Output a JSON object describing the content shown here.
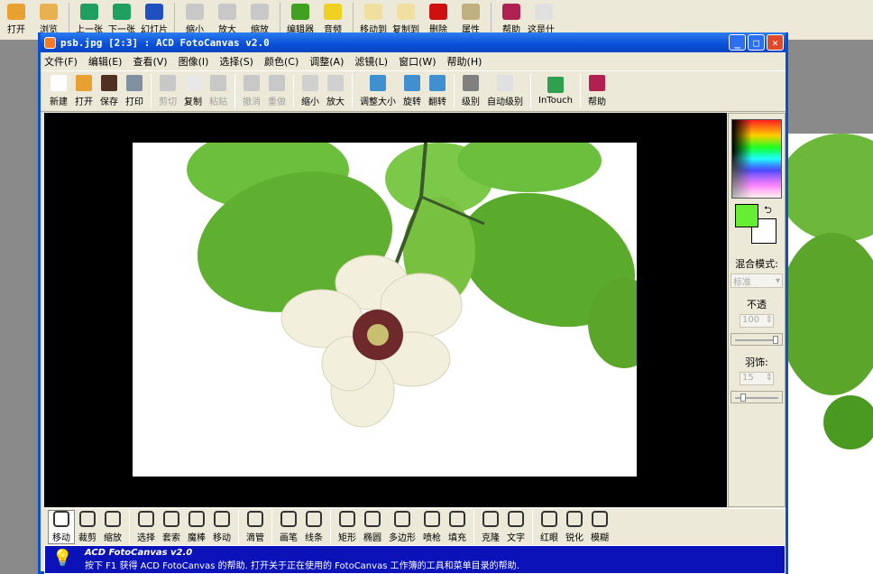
{
  "host_toolbar": [
    {
      "label": "打开",
      "icon": "open-folder-icon",
      "color": "#e8a030"
    },
    {
      "label": "浏览",
      "icon": "browse-icon",
      "color": "#e8b050"
    },
    {
      "sep": true
    },
    {
      "label": "上一张",
      "icon": "prev-icon",
      "color": "#20a060"
    },
    {
      "label": "下一张",
      "icon": "next-icon",
      "color": "#20a060"
    },
    {
      "label": "幻灯片",
      "icon": "slideshow-icon",
      "color": "#2050c0"
    },
    {
      "sep": true
    },
    {
      "label": "缩小",
      "icon": "zoom-out-icon",
      "color": "#c8c8c8"
    },
    {
      "label": "放大",
      "icon": "zoom-in-icon",
      "color": "#c8c8c8"
    },
    {
      "label": "缩放",
      "icon": "zoom-icon",
      "color": "#c8c8c8"
    },
    {
      "sep": true
    },
    {
      "label": "编辑器",
      "icon": "editor-icon",
      "color": "#40a020"
    },
    {
      "label": "音频",
      "icon": "audio-icon",
      "color": "#f0d020"
    },
    {
      "sep": true
    },
    {
      "label": "移动到",
      "icon": "move-to-icon",
      "color": "#f0e0a0"
    },
    {
      "label": "复制到",
      "icon": "copy-to-icon",
      "color": "#f0e0a0"
    },
    {
      "label": "删除",
      "icon": "delete-icon",
      "color": "#d01010"
    },
    {
      "label": "属性",
      "icon": "properties-icon",
      "color": "#c0b080"
    },
    {
      "sep": true
    },
    {
      "label": "帮助",
      "icon": "help-book-icon",
      "color": "#b02050"
    },
    {
      "label": "这是什么?",
      "icon": "whats-this-icon",
      "color": "#e0e0e0"
    }
  ],
  "window": {
    "title": "psb.jpg [2:3] : ACD FotoCanvas v2.0",
    "minimize": "_",
    "maximize": "□",
    "close": "✕"
  },
  "menu": [
    "文件(F)",
    "编辑(E)",
    "查看(V)",
    "图像(I)",
    "选择(S)",
    "颜色(C)",
    "调整(A)",
    "滤镜(L)",
    "窗口(W)",
    "帮助(H)"
  ],
  "toolbar": [
    {
      "label": "新建",
      "icon": "new-icon",
      "color": "#ffffff"
    },
    {
      "label": "打开",
      "icon": "open-icon",
      "color": "#e8a030"
    },
    {
      "label": "保存",
      "icon": "save-icon",
      "color": "#503020"
    },
    {
      "label": "打印",
      "icon": "print-icon",
      "color": "#8090a0"
    },
    {
      "sep": true
    },
    {
      "label": "剪切",
      "icon": "cut-icon",
      "color": "#c8c8c8",
      "disabled": true
    },
    {
      "label": "复制",
      "icon": "copy-icon",
      "color": "#e8e8e8"
    },
    {
      "label": "粘贴",
      "icon": "paste-icon",
      "color": "#c8c8c8",
      "disabled": true
    },
    {
      "sep": true
    },
    {
      "label": "撤消",
      "icon": "undo-icon",
      "color": "#c8c8c8",
      "disabled": true
    },
    {
      "label": "重做",
      "icon": "redo-icon",
      "color": "#c8c8c8",
      "disabled": true
    },
    {
      "sep": true
    },
    {
      "label": "缩小",
      "icon": "zoom-out-icon",
      "color": "#d0d0d0"
    },
    {
      "label": "放大",
      "icon": "zoom-in-icon",
      "color": "#d0d0d0"
    },
    {
      "sep": true
    },
    {
      "label": "调整大小",
      "icon": "resize-icon",
      "color": "#4090d0"
    },
    {
      "label": "旋转",
      "icon": "rotate-icon",
      "color": "#4090d0"
    },
    {
      "label": "翻转",
      "icon": "flip-icon",
      "color": "#4090d0"
    },
    {
      "sep": true
    },
    {
      "label": "级别",
      "icon": "levels-icon",
      "color": "#808080"
    },
    {
      "label": "自动级别",
      "icon": "auto-levels-icon",
      "color": "#e0e0e0"
    },
    {
      "sep": true
    },
    {
      "label": "InTouch",
      "icon": "intouch-globe-icon",
      "color": "#30a050"
    },
    {
      "sep": true
    },
    {
      "label": "帮助",
      "icon": "help-book-icon",
      "color": "#b02050"
    }
  ],
  "panel": {
    "blend_label": "混合模式:",
    "blend_value": "标准",
    "opacity_label": "不透",
    "opacity_value": "100",
    "opacity_level": 100,
    "feather_label": "羽饰:",
    "feather_value": "15",
    "feather_level": 15,
    "fg_color": "#66ee33",
    "bg_color": "#ffffff"
  },
  "tools": [
    {
      "label": "移动",
      "icon": "hand-icon",
      "active": true
    },
    {
      "label": "裁剪",
      "icon": "crop-icon"
    },
    {
      "label": "缩放",
      "icon": "zoom-tool-icon"
    },
    {
      "sep": true
    },
    {
      "label": "选择",
      "icon": "marquee-icon"
    },
    {
      "label": "套索",
      "icon": "lasso-icon"
    },
    {
      "label": "魔棒",
      "icon": "magic-wand-icon"
    },
    {
      "label": "移动",
      "icon": "move-arrows-icon"
    },
    {
      "sep": true
    },
    {
      "label": "滴管",
      "icon": "eyedropper-icon"
    },
    {
      "sep": true
    },
    {
      "label": "画笔",
      "icon": "pencil-icon"
    },
    {
      "label": "线条",
      "icon": "line-icon"
    },
    {
      "sep": true
    },
    {
      "label": "矩形",
      "icon": "rectangle-icon"
    },
    {
      "label": "椭圆",
      "icon": "ellipse-icon"
    },
    {
      "label": "多边形",
      "icon": "polygon-icon"
    },
    {
      "label": "喷枪",
      "icon": "airbrush-icon"
    },
    {
      "label": "填充",
      "icon": "fill-icon"
    },
    {
      "sep": true
    },
    {
      "label": "克隆",
      "icon": "clone-stamp-icon"
    },
    {
      "label": "文字",
      "icon": "text-icon"
    },
    {
      "sep": true
    },
    {
      "label": "红眼",
      "icon": "red-eye-icon"
    },
    {
      "label": "锐化",
      "icon": "sharpen-icon"
    },
    {
      "label": "模糊",
      "icon": "blur-icon"
    }
  ],
  "status": {
    "title": "ACD FotoCanvas v2.0",
    "text": "按下 F1 获得 ACD FotoCanvas 的帮助. 打开关于正在使用的 FotoCanvas 工作簿的工具和菜单目录的帮助."
  }
}
